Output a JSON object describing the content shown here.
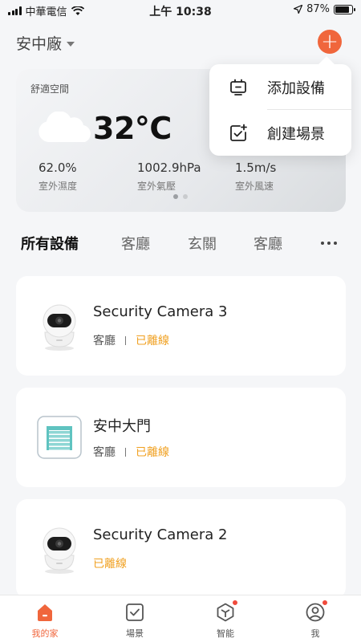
{
  "status_bar": {
    "carrier": "中華電信",
    "time": "上午 10:38",
    "battery": "87%",
    "battery_level": 0.87
  },
  "header": {
    "home_name": "安中廠",
    "add_button": "+"
  },
  "weather": {
    "label": "舒適空間",
    "temperature": "32°C",
    "stats": [
      {
        "value": "62.0%",
        "label": "室外濕度"
      },
      {
        "value": "1002.9hPa",
        "label": "室外氣壓"
      },
      {
        "value": "1.5m/s",
        "label": "室外風速"
      }
    ]
  },
  "popover": {
    "items": [
      {
        "label": "添加設備",
        "icon": "add-device-icon"
      },
      {
        "label": "創建場景",
        "icon": "create-scene-icon"
      }
    ]
  },
  "tabs": [
    "所有設備",
    "客廳",
    "玄關",
    "客廳"
  ],
  "devices": [
    {
      "name": "Security Camera 3",
      "room": "客廳",
      "status": "已離線",
      "icon": "camera-icon"
    },
    {
      "name": "安中大門",
      "room": "客廳",
      "status": "已離線",
      "icon": "garage-door-icon"
    },
    {
      "name": "Security Camera 2",
      "room": "",
      "status": "已離線",
      "icon": "camera-icon"
    }
  ],
  "bottom_nav": [
    {
      "label": "我的家",
      "icon": "home-icon",
      "active": true
    },
    {
      "label": "場景",
      "icon": "scene-icon",
      "active": false
    },
    {
      "label": "智能",
      "icon": "smart-icon",
      "active": false
    },
    {
      "label": "我",
      "icon": "profile-icon",
      "active": false
    }
  ],
  "colors": {
    "accent": "#f0663c",
    "offline": "#f0a020",
    "badge": "#f04a3c"
  }
}
